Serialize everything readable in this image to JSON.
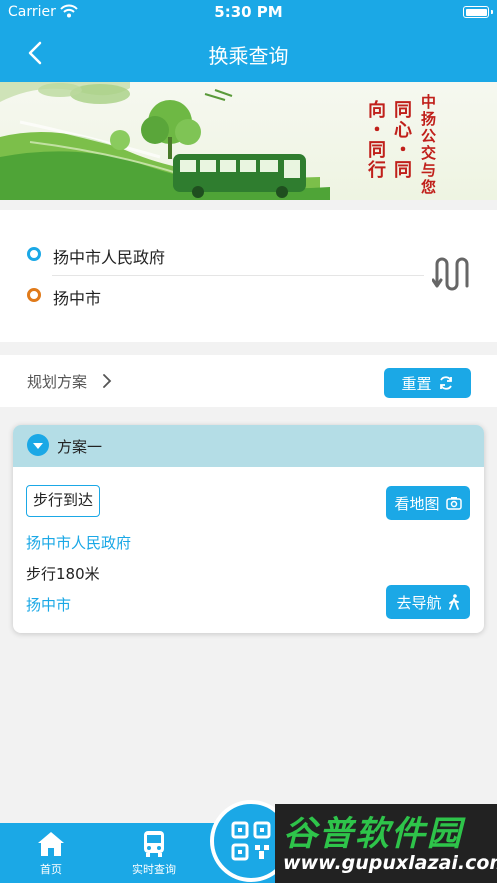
{
  "status_bar": {
    "carrier": "Carrier",
    "time": "5:30 PM"
  },
  "nav": {
    "title": "换乘查询",
    "back_icon": "chevron-left-icon"
  },
  "banner": {
    "slogan_1": "中扬公交与您",
    "slogan_2": "同心・同向・同行"
  },
  "route": {
    "origin": "扬中市人民政府",
    "destination": "扬中市",
    "swap_icon": "swap-route-icon"
  },
  "plan_bar": {
    "label": "规划方案",
    "reset_label": "重置"
  },
  "scheme": {
    "title": "方案一",
    "walk_tag": "步行到达",
    "map_button": "看地图",
    "start_stop": "扬中市人民政府",
    "walk_distance": "步行180米",
    "end_stop": "扬中市",
    "nav_button": "去导航"
  },
  "tab_bar": {
    "home": "首页",
    "realtime": "实时查询"
  },
  "watermark": {
    "title": "谷普软件园",
    "url": "www.gupuxlazai.com"
  },
  "colors": {
    "primary": "#1ba8e6",
    "origin_dot": "#1ba8e6",
    "destination_dot": "#e07a1a",
    "scheme_header": "#b4dde6"
  }
}
